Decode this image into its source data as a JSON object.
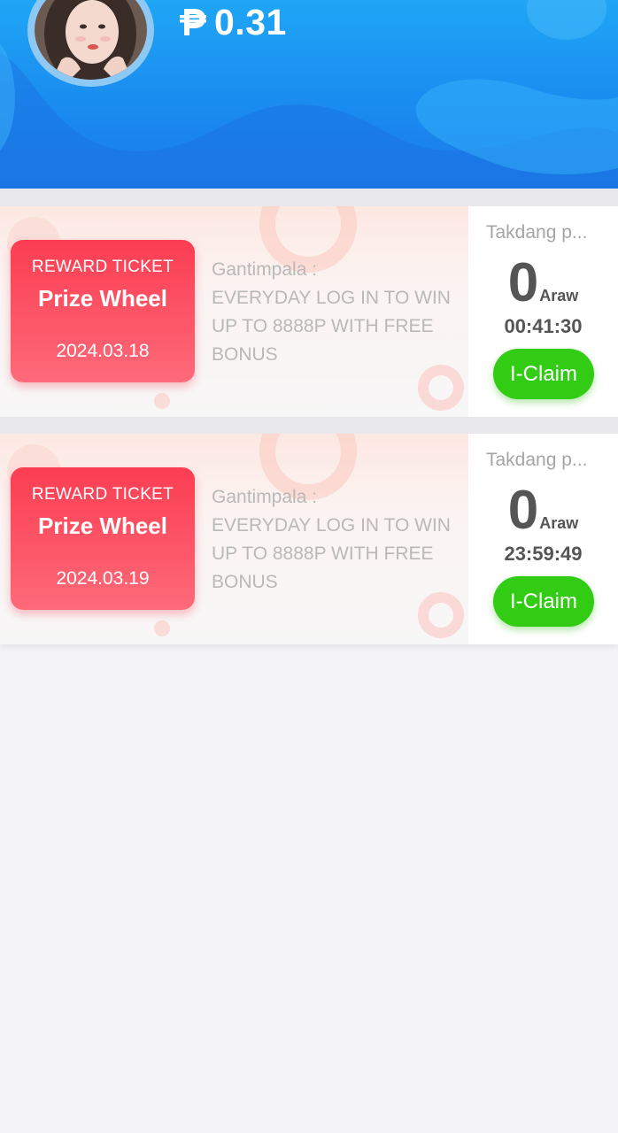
{
  "header": {
    "avatar_alt": "user avatar",
    "balance": "0.31"
  },
  "tickets": [
    {
      "kicker": "REWARD TICKET",
      "title": "Prize Wheel",
      "date": "2024.03.18",
      "prize_label": "Gantimpala :",
      "prize_lines": [
        "EVERYDAY LOG IN TO WIN",
        "UP TO 8888P WITH FREE",
        "BONUS"
      ],
      "deadline_label": "Takdang p...",
      "days": "0",
      "days_unit": "Araw",
      "time_left": "00:41:30",
      "claim_label": "I-Claim"
    },
    {
      "kicker": "REWARD TICKET",
      "title": "Prize Wheel",
      "date": "2024.03.19",
      "prize_label": "Gantimpala :",
      "prize_lines": [
        "EVERYDAY LOG IN TO WIN",
        "UP TO 8888P WITH FREE",
        "BONUS"
      ],
      "deadline_label": "Takdang p...",
      "days": "0",
      "days_unit": "Araw",
      "time_left": "23:59:49",
      "claim_label": "I-Claim"
    }
  ],
  "colors": {
    "header_blue": "#1a8cf0",
    "ticket_red": "#fb3d52",
    "claim_green": "#33cc15"
  }
}
